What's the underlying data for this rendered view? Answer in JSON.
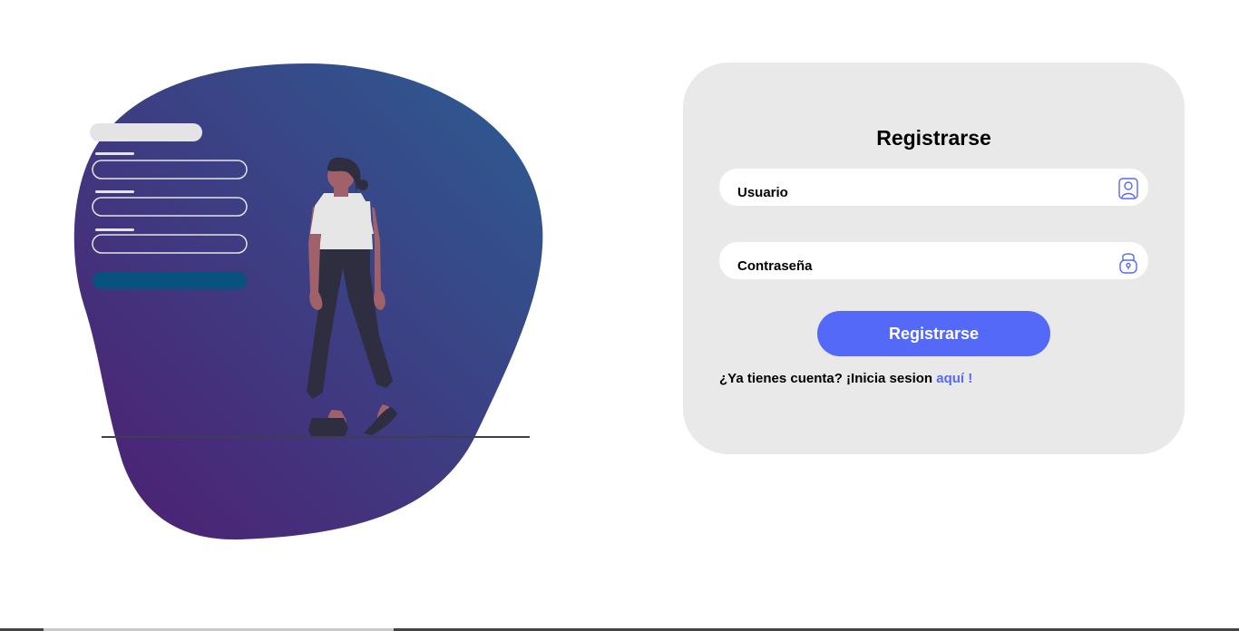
{
  "illustration": {
    "icon": "person-standing-beside-form-illustration"
  },
  "form": {
    "title": "Registrarse",
    "username": {
      "placeholder": "Usuario",
      "value": "",
      "icon": "user-icon"
    },
    "password": {
      "placeholder": "Contraseña",
      "value": "",
      "icon": "lock-icon"
    },
    "submit_label": "Registrarse",
    "login_prompt": "¿Ya tienes cuenta? ¡Inicia sesion",
    "login_link": "aquí !"
  },
  "colors": {
    "accent": "#5469f8",
    "card_background": "#e9e9e9",
    "blob_gradient_start": "#2c5d92",
    "blob_gradient_end": "#4f1d72"
  }
}
